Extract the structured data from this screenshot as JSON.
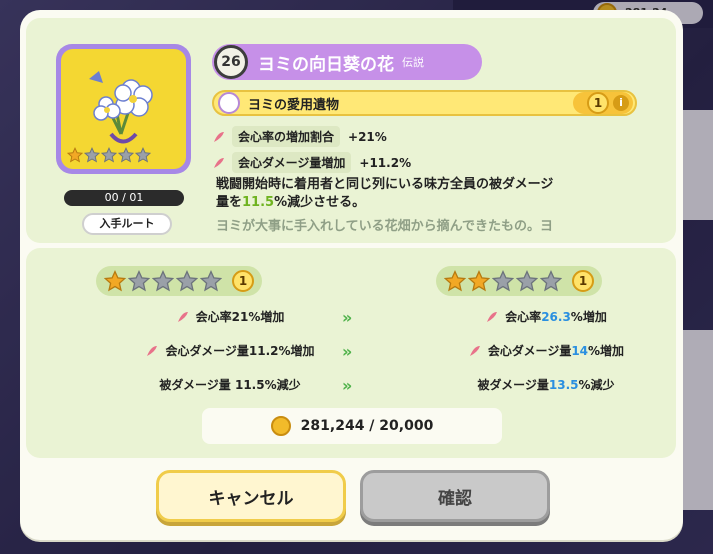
{
  "top_bar": {
    "coins": "281,24"
  },
  "item": {
    "level": "26",
    "name": "ヨミの向日葵の花",
    "rarity": "伝説",
    "owner": "ヨミの愛用遺物",
    "count": "1",
    "info": "i",
    "progress": "00 / 01",
    "route_label": "入手ルート",
    "stars_filled": 1,
    "stars_total": 5,
    "stats": [
      {
        "label": "会心率の増加割合",
        "value": "+21%"
      },
      {
        "label": "会心ダメージ量増加",
        "value": "+11.2%"
      }
    ],
    "desc_line1": "戦闘開始時に着用者と同じ列にいる味方全員の被ダメージ",
    "desc_prefix": "量を",
    "desc_highlight": "11.5",
    "desc_suffix": "%減少させる。",
    "lore": "ヨミが大事に手入れしている花畑から摘んできたもの。ヨ"
  },
  "upgrade": {
    "from_stars": 1,
    "to_stars": 2,
    "from_badge": "1",
    "to_badge": "1",
    "rows": [
      {
        "left": "会心率21%増加",
        "right_pre": "会心率",
        "right_val": "26.3",
        "right_post": "%増加",
        "icon": true
      },
      {
        "left": "会心ダメージ量11.2%増加",
        "right_pre": "会心ダメージ量",
        "right_val": "14",
        "right_post": "%増加",
        "icon": true
      },
      {
        "left": "被ダメージ量 11.5%減少",
        "right_pre": "被ダメージ量 ",
        "right_val": "13.5",
        "right_post": "%減少",
        "icon": false
      }
    ],
    "arrow": "»",
    "cost": "281,244 / 20,000"
  },
  "buttons": {
    "cancel": "キャンセル",
    "confirm": "確認"
  },
  "colors": {
    "accent_purple": "#c690e8",
    "highlight_green": "#6fb320",
    "highlight_blue": "#2a8fe0",
    "star_gold": "#f2a825",
    "star_gray": "#9aa0a8"
  }
}
